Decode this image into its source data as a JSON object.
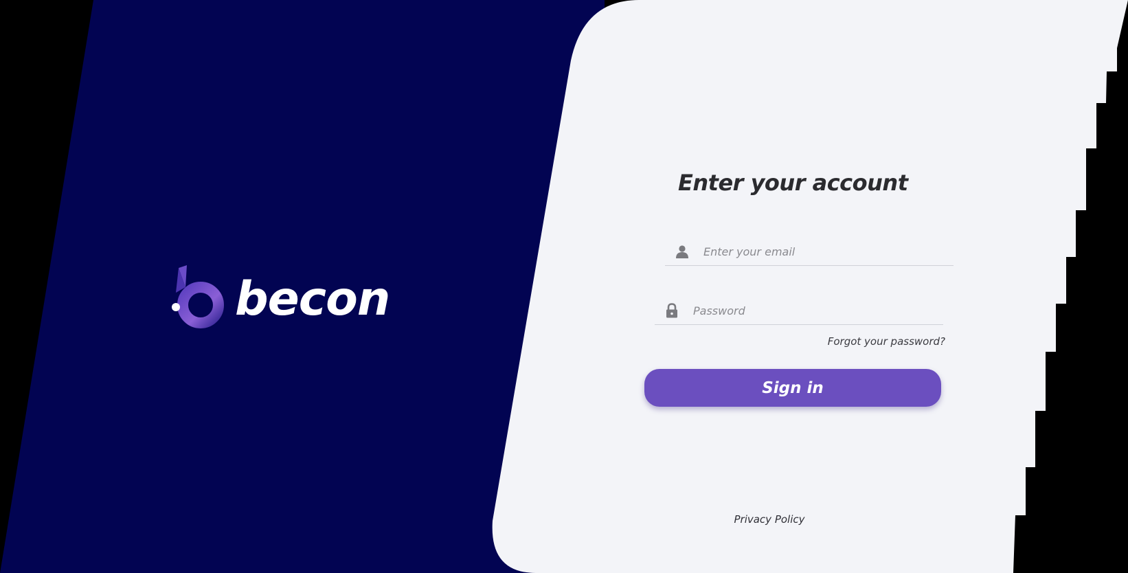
{
  "brand": {
    "name": "becon",
    "logo_icon": "becon-b-logo-icon",
    "colors": {
      "left_panel": "#020452",
      "right_panel": "#f3f4f8",
      "accent": "#6b4fbf",
      "background": "#000000"
    }
  },
  "login": {
    "title": "Enter your account",
    "email": {
      "placeholder": "Enter your email",
      "value": "",
      "icon": "user-icon"
    },
    "password": {
      "placeholder": "Password",
      "value": "",
      "icon": "lock-icon"
    },
    "forgot_password_label": "Forgot your password?",
    "sign_in_label": "Sign in"
  },
  "footer": {
    "privacy_label": "Privacy Policy"
  }
}
